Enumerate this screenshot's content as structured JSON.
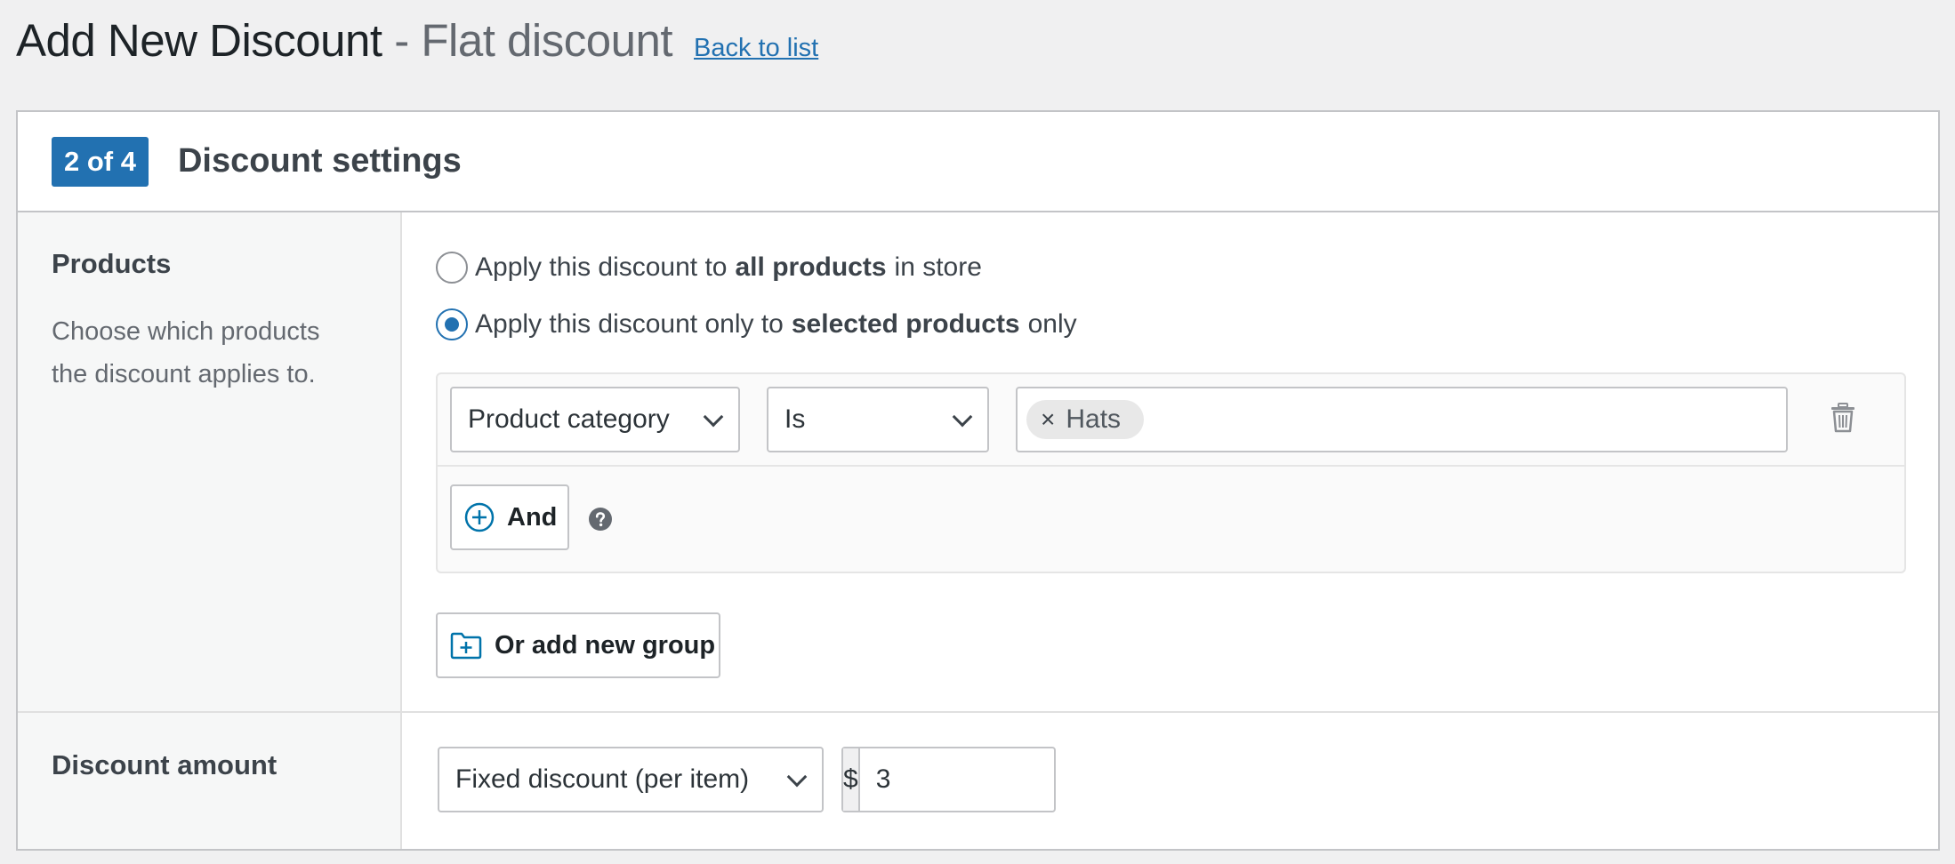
{
  "header": {
    "title": "Add New Discount",
    "separator": "-",
    "discount_type": "Flat discount",
    "back_link": "Back to list"
  },
  "card": {
    "step_badge": "2 of 4",
    "title": "Discount settings"
  },
  "products": {
    "label": "Products",
    "description": "Choose which products the discount applies to.",
    "options": [
      {
        "prefix": "Apply this discount to",
        "bold": "all products",
        "suffix": "in store",
        "checked": false
      },
      {
        "prefix": "Apply this discount only to",
        "bold": "selected products",
        "suffix": "only",
        "checked": true
      }
    ],
    "condition": {
      "field": "Product category",
      "operator": "Is",
      "tokens": [
        "Hats"
      ],
      "token_remove": "×"
    },
    "and_button": "And",
    "add_group_button": "Or add new group"
  },
  "discount_amount": {
    "label": "Discount amount",
    "type_select": "Fixed discount (per item)",
    "currency": "$",
    "value": "3"
  },
  "colors": {
    "accent": "#2271b1",
    "background": "#f0f0f1",
    "border": "#c3c4c7",
    "icon": "#0073aa"
  },
  "icons": {
    "trash": "trash-icon",
    "add": "plus-circle-icon",
    "help": "help-icon",
    "folder": "folder-plus-icon",
    "chevron": "chevron-down-icon"
  }
}
